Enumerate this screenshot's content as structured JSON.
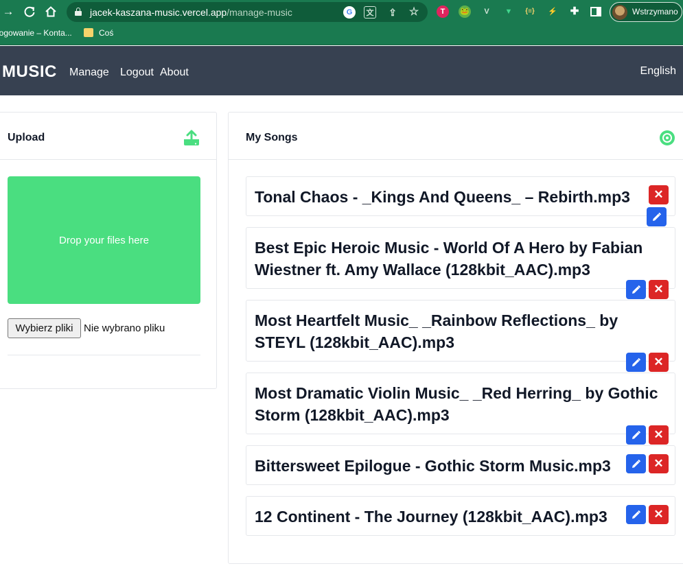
{
  "browser": {
    "url_host": "jacek-kaszana-music.vercel.app",
    "url_path": "/manage-music",
    "profile_label": "Wstrzymano",
    "bookmarks": [
      "Logowanie – Konta...",
      "Coś"
    ],
    "theme_color": "#1a7a50"
  },
  "header": {
    "brand": "MUSIC",
    "nav": [
      "Manage",
      "Logout",
      "About"
    ],
    "language": "English",
    "bg_color": "#374151"
  },
  "upload": {
    "title": "Upload",
    "dropzone_text": "Drop your files here",
    "file_button": "Wybierz pliki",
    "file_status": "Nie wybrano pliku",
    "accent_color": "#4ade80"
  },
  "songs_panel": {
    "title": "My Songs",
    "songs": [
      "Tonal Chaos - _Kings And Queens_ – Rebirth.mp3",
      "Best Epic Heroic Music - World Of A Hero by Fabian Wiestner ft. Amy Wallace (128kbit_AAC).mp3",
      "Most Heartfelt Music_ _Rainbow Reflections_ by STEYL (128kbit_AAC).mp3",
      "Most Dramatic Violin Music_ _Red Herring_ by Gothic Storm (128kbit_AAC).mp3",
      "Bittersweet Epilogue - Gothic Storm Music.mp3",
      "12 Continent - The Journey (128kbit_AAC).mp3"
    ],
    "delete_label": "✕",
    "edit_color": "#2563eb",
    "delete_color": "#dc2626"
  }
}
